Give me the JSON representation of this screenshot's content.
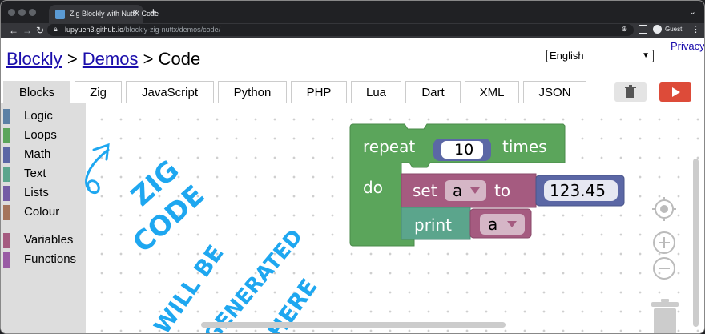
{
  "browser": {
    "tab_title": "Zig Blockly with NuttX Code",
    "tab_close": "×",
    "new_tab": "+",
    "url_domain": "lupyuen3.github.io",
    "url_path": "/blockly-zig-nuttx/demos/code/",
    "profile": "Guest"
  },
  "page": {
    "breadcrumb_blockly": "Blockly",
    "breadcrumb_sep1": ">",
    "breadcrumb_demos": "Demos",
    "breadcrumb_sep2": ">",
    "breadcrumb_code": "Code",
    "privacy": "Privacy",
    "language": "English"
  },
  "tabs": [
    {
      "label": "Blocks"
    },
    {
      "label": "Zig"
    },
    {
      "label": "JavaScript"
    },
    {
      "label": "Python"
    },
    {
      "label": "PHP"
    },
    {
      "label": "Lua"
    },
    {
      "label": "Dart"
    },
    {
      "label": "XML"
    },
    {
      "label": "JSON"
    }
  ],
  "toolbox": [
    {
      "label": "Logic",
      "color": "#5b80a5"
    },
    {
      "label": "Loops",
      "color": "#5ba55b"
    },
    {
      "label": "Math",
      "color": "#5b67a5"
    },
    {
      "label": "Text",
      "color": "#5ba58c"
    },
    {
      "label": "Lists",
      "color": "#745ba5"
    },
    {
      "label": "Colour",
      "color": "#a5745b"
    },
    {
      "label": "Variables",
      "color": "#a55b80"
    },
    {
      "label": "Functions",
      "color": "#995ba5"
    }
  ],
  "blocks": {
    "repeat_label": "repeat",
    "repeat_count": "10",
    "times_label": "times",
    "do_label": "do",
    "set_label": "set",
    "set_var": "a",
    "to_label": "to",
    "number_value": "123.45",
    "print_label": "print",
    "print_var": "a",
    "loop_color": "#5ba55b",
    "var_color": "#a55b80",
    "math_color": "#5b67a5",
    "text_color": "#5ba58c"
  },
  "annotation": {
    "line1": "ZIG",
    "line2": "CODE",
    "line3": "WILL BE",
    "line4": "GENERATED",
    "line5": "HERE",
    "color": "#1ea7f0"
  }
}
